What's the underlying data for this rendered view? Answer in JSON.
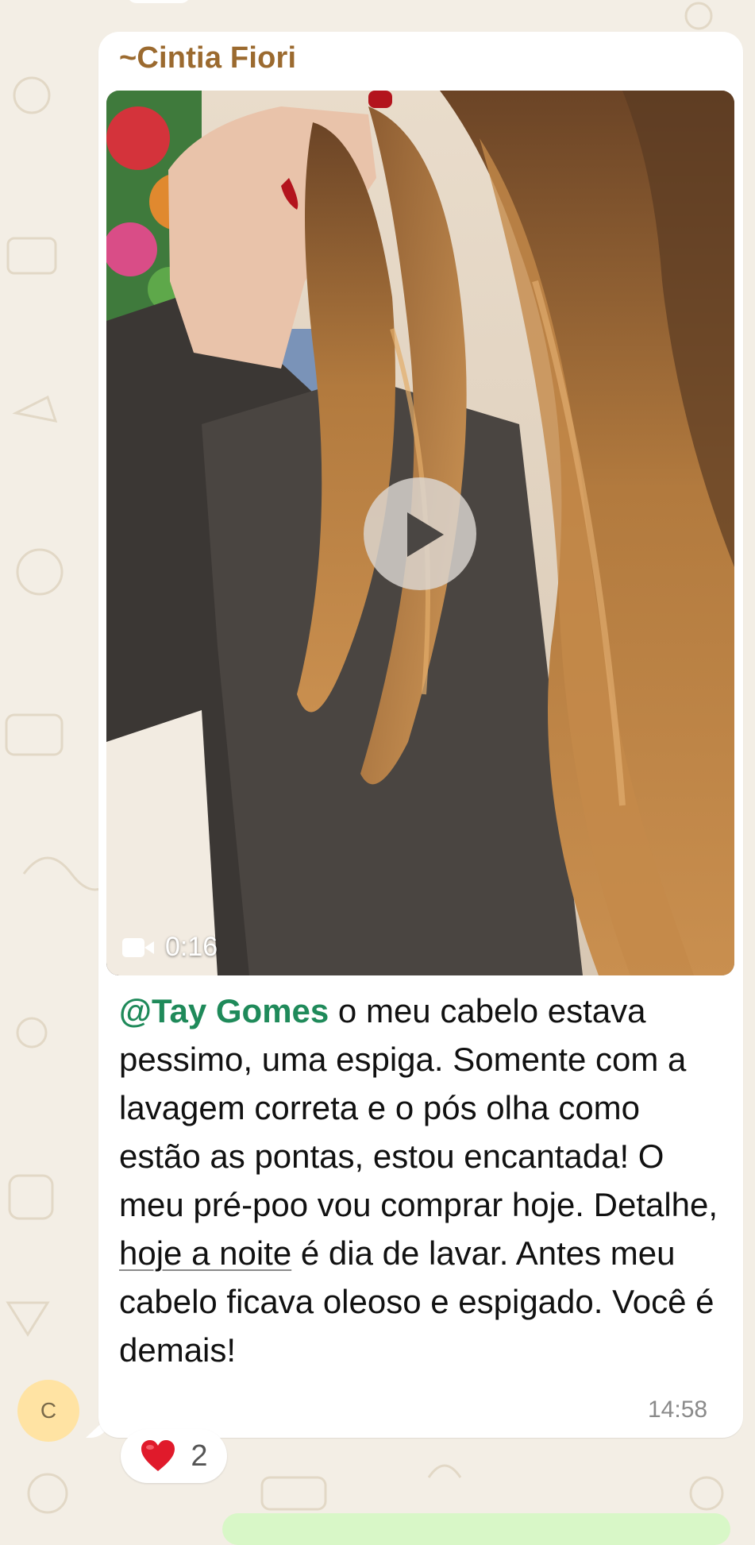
{
  "message": {
    "sender": "~Cintia Fiori",
    "video": {
      "duration": "0:16"
    },
    "mention": "@Tay Gomes",
    "text_part1": " o meu cabelo estava pessimo, uma espiga. Somente com a lavagem correta e o pós olha como estão as pontas, estou encantada! O meu pré-poo vou comprar hoje. Detalhe, ",
    "link_text": "hoje a noite",
    "text_part2": " é dia de lavar. Antes meu cabelo ficava oleoso e espigado. Você é demais!",
    "time": "14:58",
    "avatar_initial": "C",
    "reaction": {
      "emoji": "heart-icon",
      "count": "2"
    }
  },
  "colors": {
    "background": "#f3eee5",
    "bubble": "#ffffff",
    "sender_name": "#9b6a2f",
    "mention": "#1f8a5a",
    "avatar_bg": "#ffe3a3",
    "heart": "#e01a2b"
  }
}
